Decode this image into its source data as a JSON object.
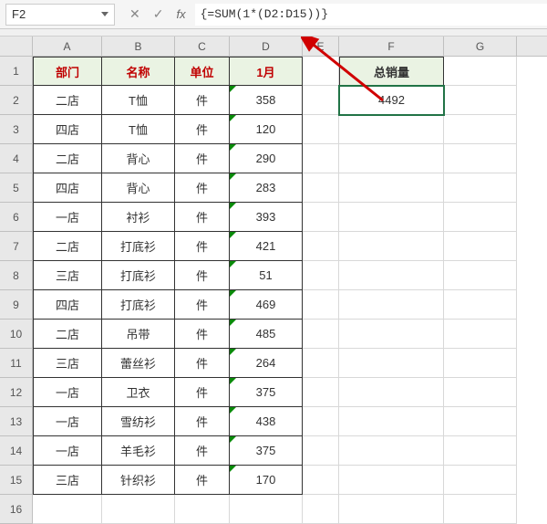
{
  "name_box": "F2",
  "formula": "{=SUM(1*(D2:D15))}",
  "column_headers": [
    "A",
    "B",
    "C",
    "D",
    "E",
    "F",
    "G"
  ],
  "row_headers": [
    "1",
    "2",
    "3",
    "4",
    "5",
    "6",
    "7",
    "8",
    "9",
    "10",
    "11",
    "12",
    "13",
    "14",
    "15",
    "16"
  ],
  "table": {
    "headers": [
      "部门",
      "名称",
      "单位",
      "1月"
    ],
    "rows": [
      [
        "二店",
        "T恤",
        "件",
        "358"
      ],
      [
        "四店",
        "T恤",
        "件",
        "120"
      ],
      [
        "二店",
        "背心",
        "件",
        "290"
      ],
      [
        "四店",
        "背心",
        "件",
        "283"
      ],
      [
        "一店",
        "衬衫",
        "件",
        "393"
      ],
      [
        "二店",
        "打底衫",
        "件",
        "421"
      ],
      [
        "三店",
        "打底衫",
        "件",
        "51"
      ],
      [
        "四店",
        "打底衫",
        "件",
        "469"
      ],
      [
        "二店",
        "吊带",
        "件",
        "485"
      ],
      [
        "三店",
        "蕾丝衫",
        "件",
        "264"
      ],
      [
        "一店",
        "卫衣",
        "件",
        "375"
      ],
      [
        "一店",
        "雪纺衫",
        "件",
        "438"
      ],
      [
        "一店",
        "羊毛衫",
        "件",
        "375"
      ],
      [
        "三店",
        "针织衫",
        "件",
        "170"
      ]
    ]
  },
  "summary": {
    "header": "总销量",
    "value": "4492"
  },
  "chart_data": {
    "type": "table",
    "title": "",
    "columns": [
      "部门",
      "名称",
      "单位",
      "1月"
    ],
    "rows": [
      [
        "二店",
        "T恤",
        "件",
        358
      ],
      [
        "四店",
        "T恤",
        "件",
        120
      ],
      [
        "二店",
        "背心",
        "件",
        290
      ],
      [
        "四店",
        "背心",
        "件",
        283
      ],
      [
        "一店",
        "衬衫",
        "件",
        393
      ],
      [
        "二店",
        "打底衫",
        "件",
        421
      ],
      [
        "三店",
        "打底衫",
        "件",
        51
      ],
      [
        "四店",
        "打底衫",
        "件",
        469
      ],
      [
        "二店",
        "吊带",
        "件",
        485
      ],
      [
        "三店",
        "蕾丝衫",
        "件",
        264
      ],
      [
        "一店",
        "卫衣",
        "件",
        375
      ],
      [
        "一店",
        "雪纺衫",
        "件",
        438
      ],
      [
        "一店",
        "羊毛衫",
        "件",
        375
      ],
      [
        "三店",
        "针织衫",
        "件",
        170
      ]
    ],
    "summary_label": "总销量",
    "summary_value": 4492
  }
}
